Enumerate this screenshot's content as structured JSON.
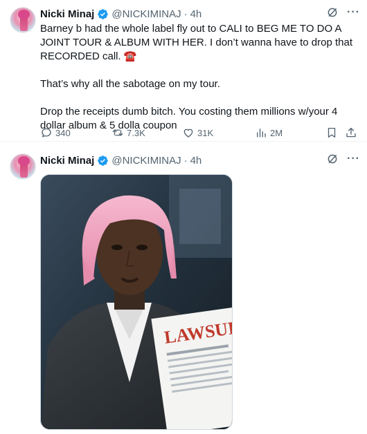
{
  "tweets": [
    {
      "author": {
        "name": "Nicki Minaj",
        "handle": "@NICKIMINAJ",
        "time": "4h"
      },
      "text": [
        "Barney b had the whole label fly out to CALI to BEG ME TO DO A JOINT TOUR & ALBUM WITH HER. I don’t wanna have to drop that RECORDED call. ☎️",
        "That’s why all the sabotage on my tour.",
        "Drop the receipts dumb bitch. You costing them millions w/your 4 dollar album & 5 dolla coupon"
      ],
      "stats": {
        "replies": "340",
        "reposts": "7.3K",
        "likes": "31K",
        "views": "2M"
      }
    },
    {
      "author": {
        "name": "Nicki Minaj",
        "handle": "@NICKIMINAJ",
        "time": "4h"
      },
      "media": {
        "paper_text": "LAWSUIT"
      }
    }
  ],
  "colors": {
    "verified": "#1d9bf0",
    "secondary_text": "#536471",
    "primary_text": "#0f1419"
  },
  "icons": [
    "verified-badge-icon",
    "grok-icon",
    "more-icon",
    "reply-icon",
    "repost-icon",
    "like-icon",
    "views-icon",
    "bookmark-icon",
    "share-icon"
  ]
}
